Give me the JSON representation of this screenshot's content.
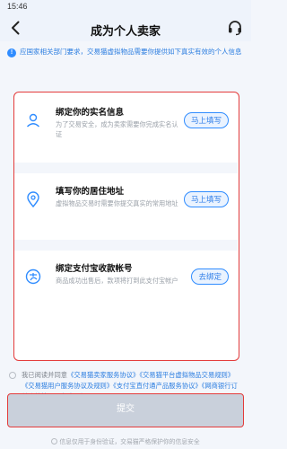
{
  "status_bar": {
    "time": "15:46"
  },
  "nav": {
    "title": "成为个人卖家"
  },
  "notice": {
    "text": "应国家相关部门要求，交易猫虚拟物品需要你提供如下真实有效的个人信息"
  },
  "steps": [
    {
      "icon": "person-icon",
      "title": "绑定你的实名信息",
      "desc": "为了交易安全，成为卖家需要你完成实名认证",
      "button": "马上填写"
    },
    {
      "icon": "location-icon",
      "title": "填写你的居住地址",
      "desc": "虚拟物品交易时需要你提交真实的常用地址",
      "button": "马上填写"
    },
    {
      "icon": "alipay-icon",
      "title": "绑定支付宝收款帐号",
      "desc": "商品成功出售后，款项将打到此支付宝帐户",
      "button": "去绑定"
    }
  ],
  "agreement": {
    "prefix": "我已阅读并同意",
    "links": [
      "《交易猫卖家服务协议》",
      "《交易猫平台虚拟物品交易规则》",
      "《交易猫用户服务协议及规则》",
      "《支付宝直付通产品服务协议》",
      "《网商银行订单账款管理服务合同》"
    ]
  },
  "submit_label": "提交",
  "footer": "信息仅用于身份验证，交易猫严格保护你的信息安全",
  "colors": {
    "accent": "#2f8cff",
    "highlight": "#e43b3b",
    "disabled": "#c9d0db"
  }
}
